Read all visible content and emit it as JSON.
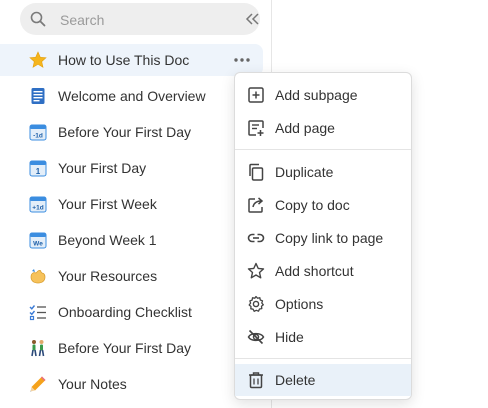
{
  "search": {
    "placeholder": "Search"
  },
  "sidebar": {
    "items": [
      {
        "label": "How to Use This Doc",
        "icon": "star-icon"
      },
      {
        "label": "Welcome and Overview",
        "icon": "document-icon"
      },
      {
        "label": "Before Your First Day",
        "icon": "calendar-minus-1d-icon"
      },
      {
        "label": "Your First Day",
        "icon": "calendar-1-icon"
      },
      {
        "label": "Your First Week",
        "icon": "calendar-plus-1d-icon"
      },
      {
        "label": "Beyond Week 1",
        "icon": "calendar-week-icon"
      },
      {
        "label": "Your Resources",
        "icon": "hand-icon"
      },
      {
        "label": "Onboarding Checklist",
        "icon": "checklist-icon"
      },
      {
        "label": "Before Your First Day",
        "icon": "people-walking-icon"
      },
      {
        "label": "Your Notes",
        "icon": "pencil-icon"
      }
    ],
    "selected_index": 0
  },
  "context_menu": {
    "items": [
      {
        "label": "Add subpage",
        "icon": "add-subpage-icon"
      },
      {
        "label": "Add page",
        "icon": "add-page-icon"
      },
      {
        "label": "Duplicate",
        "icon": "duplicate-icon"
      },
      {
        "label": "Copy to doc",
        "icon": "copy-to-doc-icon"
      },
      {
        "label": "Copy link to page",
        "icon": "link-icon"
      },
      {
        "label": "Add shortcut",
        "icon": "star-outline-icon"
      },
      {
        "label": "Options",
        "icon": "gear-icon"
      },
      {
        "label": "Hide",
        "icon": "eye-off-icon"
      },
      {
        "label": "Delete",
        "icon": "trash-icon"
      }
    ],
    "hovered_item": "Delete"
  },
  "colors": {
    "accent": "#3b8de0",
    "selected_bg": "#eef4fb",
    "hover_bg": "#e9f1f9"
  }
}
